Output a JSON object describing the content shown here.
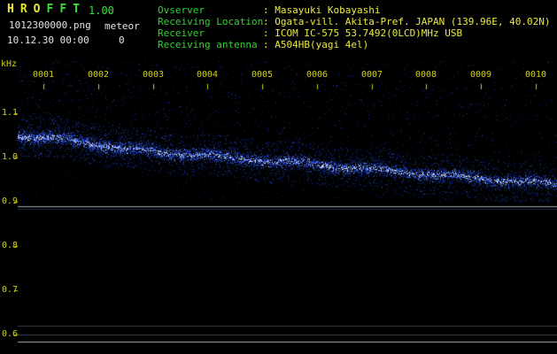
{
  "app": {
    "title_letters": [
      {
        "ch": "H",
        "color": "#e8e832"
      },
      {
        "ch": "R",
        "color": "#e8e832"
      },
      {
        "ch": "O",
        "color": "#e8e832"
      },
      {
        "ch": "F",
        "color": "#3ae03a"
      },
      {
        "ch": "F",
        "color": "#3ae03a"
      },
      {
        "ch": "T",
        "color": "#3ae03a"
      }
    ],
    "version": "1.00"
  },
  "header": {
    "filename": "1012300000.png",
    "mode_label": "meteor",
    "meteor_count": "0",
    "datetime": "10.12.30 00:00",
    "info": [
      {
        "label": "Ovserver",
        "value": "Masayuki Kobayashi"
      },
      {
        "label": "Receiving Location",
        "value": "Ogata-vill. Akita-Pref. JAPAN (139.96E, 40.02N)"
      },
      {
        "label": "Receiver",
        "value": "ICOM IC-575 53.7492(0LCD)MHz USB"
      },
      {
        "label": "Receiving antenna",
        "value": "A504HB(yagi 4el)"
      }
    ]
  },
  "chart_data": {
    "type": "heatmap",
    "title": "HROFFT meteor radio observation spectrogram 2010-12-30 00:00-00:10",
    "x_labels": [
      "0001",
      "0002",
      "0003",
      "0004",
      "0005",
      "0006",
      "0007",
      "0008",
      "0009",
      "0010"
    ],
    "x_unit": "minute",
    "y_unit": "kHz",
    "y_ticks": [
      "1.1",
      "1.0",
      "0.9",
      "0.8",
      "0.7",
      "0.6"
    ],
    "y_tick_values": [
      1.1,
      1.0,
      0.9,
      0.8,
      0.7,
      0.6
    ],
    "ylim_khz": [
      0.56,
      1.22
    ],
    "noise_band_center_khz": [
      1.05,
      1.04,
      1.02,
      1.01,
      1.0,
      0.99,
      0.98,
      0.97,
      0.96,
      0.95,
      0.94
    ],
    "noise_band_halfwidth_khz": 0.045,
    "meteor_echoes": [],
    "h_lines": [
      {
        "khz": 0.89,
        "color": "#97a6b4"
      },
      {
        "khz": 0.884,
        "color": "#1f2a44"
      },
      {
        "khz": 0.62,
        "color": "#3e3e48"
      },
      {
        "khz": 0.6,
        "color": "#3e3e48"
      },
      {
        "khz": 0.585,
        "color": "#a9aeb6"
      }
    ],
    "colors": {
      "background": "#000000",
      "axis": "#d0d010",
      "noise_dim": "#0b1c52",
      "noise_mid1": "#1a38a8",
      "noise_mid2": "#2e55e8",
      "noise_bright": "#7f9fff",
      "noise_peak": "#e6f0ff"
    }
  }
}
